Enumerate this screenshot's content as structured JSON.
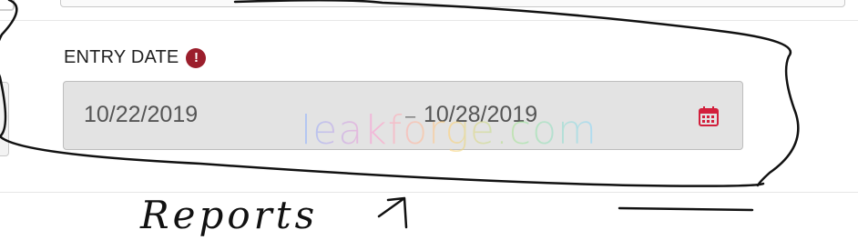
{
  "field": {
    "label": "ENTRY DATE",
    "required_icon": "alert-circle-icon",
    "start_date": "10/22/2019",
    "separator": "–",
    "end_date": "10/28/2019",
    "calendar_icon": "calendar-icon"
  },
  "overlay": {
    "watermark": "leakforge.com",
    "annotation_text": "Reports"
  },
  "colors": {
    "alert": "#9b1e2c",
    "calendar": "#d21f3c",
    "input_bg": "#e3e3e3"
  }
}
